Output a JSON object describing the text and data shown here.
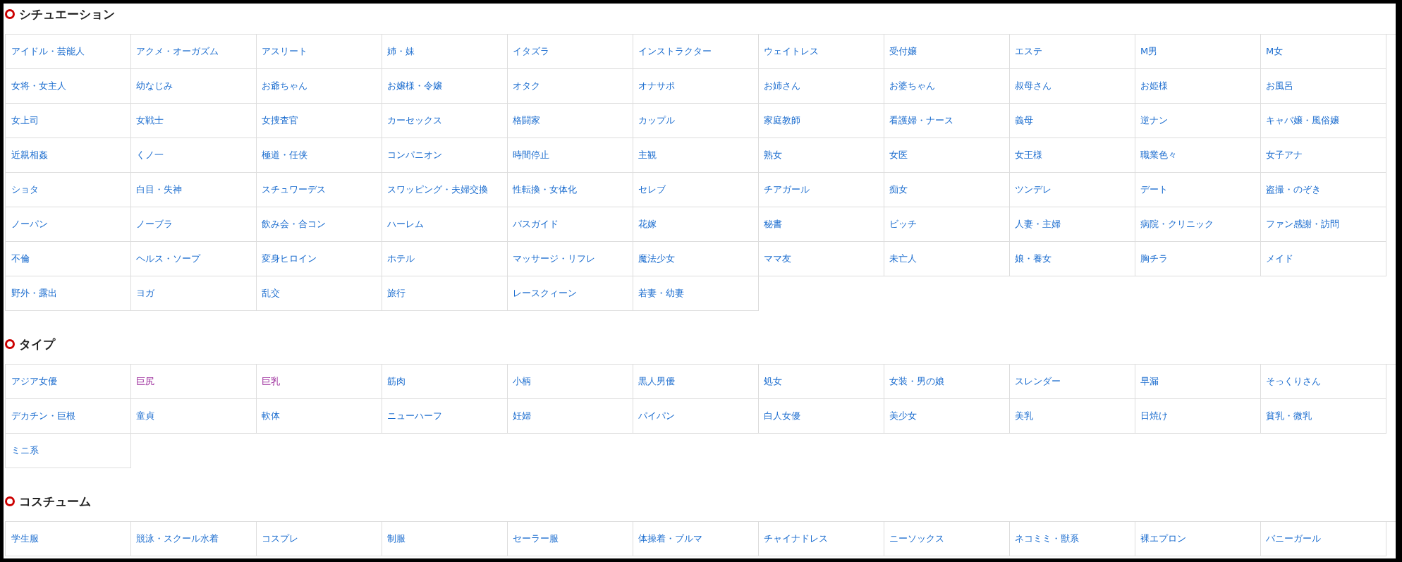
{
  "sections": [
    {
      "title": "シチュエーション",
      "items": [
        {
          "label": "アイドル・芸能人",
          "visited": false
        },
        {
          "label": "アクメ・オーガズム",
          "visited": false
        },
        {
          "label": "アスリート",
          "visited": false
        },
        {
          "label": "姉・妹",
          "visited": false
        },
        {
          "label": "イタズラ",
          "visited": false
        },
        {
          "label": "インストラクター",
          "visited": false
        },
        {
          "label": "ウェイトレス",
          "visited": false
        },
        {
          "label": "受付嬢",
          "visited": false
        },
        {
          "label": "エステ",
          "visited": false
        },
        {
          "label": "M男",
          "visited": false
        },
        {
          "label": "M女",
          "visited": false
        },
        {
          "label": "女将・女主人",
          "visited": false
        },
        {
          "label": "幼なじみ",
          "visited": false
        },
        {
          "label": "お爺ちゃん",
          "visited": false
        },
        {
          "label": "お嬢様・令嬢",
          "visited": false
        },
        {
          "label": "オタク",
          "visited": false
        },
        {
          "label": "オナサポ",
          "visited": false
        },
        {
          "label": "お姉さん",
          "visited": false
        },
        {
          "label": "お婆ちゃん",
          "visited": false
        },
        {
          "label": "叔母さん",
          "visited": false
        },
        {
          "label": "お姫様",
          "visited": false
        },
        {
          "label": "お風呂",
          "visited": false
        },
        {
          "label": "女上司",
          "visited": false
        },
        {
          "label": "女戦士",
          "visited": false
        },
        {
          "label": "女捜査官",
          "visited": false
        },
        {
          "label": "カーセックス",
          "visited": false
        },
        {
          "label": "格闘家",
          "visited": false
        },
        {
          "label": "カップル",
          "visited": false
        },
        {
          "label": "家庭教師",
          "visited": false
        },
        {
          "label": "看護婦・ナース",
          "visited": false
        },
        {
          "label": "義母",
          "visited": false
        },
        {
          "label": "逆ナン",
          "visited": false
        },
        {
          "label": "キャバ嬢・風俗嬢",
          "visited": false
        },
        {
          "label": "近親相姦",
          "visited": false
        },
        {
          "label": "くノ一",
          "visited": false
        },
        {
          "label": "極道・任侠",
          "visited": false
        },
        {
          "label": "コンパニオン",
          "visited": false
        },
        {
          "label": "時間停止",
          "visited": false
        },
        {
          "label": "主観",
          "visited": false
        },
        {
          "label": "熟女",
          "visited": false
        },
        {
          "label": "女医",
          "visited": false
        },
        {
          "label": "女王様",
          "visited": false
        },
        {
          "label": "職業色々",
          "visited": false
        },
        {
          "label": "女子アナ",
          "visited": false
        },
        {
          "label": "ショタ",
          "visited": false
        },
        {
          "label": "白目・失神",
          "visited": false
        },
        {
          "label": "スチュワーデス",
          "visited": false
        },
        {
          "label": "スワッピング・夫婦交換",
          "visited": false
        },
        {
          "label": "性転換・女体化",
          "visited": false
        },
        {
          "label": "セレブ",
          "visited": false
        },
        {
          "label": "チアガール",
          "visited": false
        },
        {
          "label": "痴女",
          "visited": false
        },
        {
          "label": "ツンデレ",
          "visited": false
        },
        {
          "label": "デート",
          "visited": false
        },
        {
          "label": "盗撮・のぞき",
          "visited": false
        },
        {
          "label": "ノーパン",
          "visited": false
        },
        {
          "label": "ノーブラ",
          "visited": false
        },
        {
          "label": "飲み会・合コン",
          "visited": false
        },
        {
          "label": "ハーレム",
          "visited": false
        },
        {
          "label": "バスガイド",
          "visited": false
        },
        {
          "label": "花嫁",
          "visited": false
        },
        {
          "label": "秘書",
          "visited": false
        },
        {
          "label": "ビッチ",
          "visited": false
        },
        {
          "label": "人妻・主婦",
          "visited": false
        },
        {
          "label": "病院・クリニック",
          "visited": false
        },
        {
          "label": "ファン感謝・訪問",
          "visited": false
        },
        {
          "label": "不倫",
          "visited": false
        },
        {
          "label": "ヘルス・ソープ",
          "visited": false
        },
        {
          "label": "変身ヒロイン",
          "visited": false
        },
        {
          "label": "ホテル",
          "visited": false
        },
        {
          "label": "マッサージ・リフレ",
          "visited": false
        },
        {
          "label": "魔法少女",
          "visited": false
        },
        {
          "label": "ママ友",
          "visited": false
        },
        {
          "label": "未亡人",
          "visited": false
        },
        {
          "label": "娘・養女",
          "visited": false
        },
        {
          "label": "胸チラ",
          "visited": false
        },
        {
          "label": "メイド",
          "visited": false
        },
        {
          "label": "野外・露出",
          "visited": false
        },
        {
          "label": "ヨガ",
          "visited": false
        },
        {
          "label": "乱交",
          "visited": false
        },
        {
          "label": "旅行",
          "visited": false
        },
        {
          "label": "レースクィーン",
          "visited": false
        },
        {
          "label": "若妻・幼妻",
          "visited": false
        }
      ]
    },
    {
      "title": "タイプ",
      "items": [
        {
          "label": "アジア女優",
          "visited": false
        },
        {
          "label": "巨尻",
          "visited": true
        },
        {
          "label": "巨乳",
          "visited": true
        },
        {
          "label": "筋肉",
          "visited": false
        },
        {
          "label": "小柄",
          "visited": false
        },
        {
          "label": "黒人男優",
          "visited": false
        },
        {
          "label": "処女",
          "visited": false
        },
        {
          "label": "女装・男の娘",
          "visited": false
        },
        {
          "label": "スレンダー",
          "visited": false
        },
        {
          "label": "早漏",
          "visited": false
        },
        {
          "label": "そっくりさん",
          "visited": false
        },
        {
          "label": "デカチン・巨根",
          "visited": false
        },
        {
          "label": "童貞",
          "visited": false
        },
        {
          "label": "軟体",
          "visited": false
        },
        {
          "label": "ニューハーフ",
          "visited": false
        },
        {
          "label": "妊婦",
          "visited": false
        },
        {
          "label": "パイパン",
          "visited": false
        },
        {
          "label": "白人女優",
          "visited": false
        },
        {
          "label": "美少女",
          "visited": false
        },
        {
          "label": "美乳",
          "visited": false
        },
        {
          "label": "日焼け",
          "visited": false
        },
        {
          "label": "貧乳・微乳",
          "visited": false
        },
        {
          "label": "ミニ系",
          "visited": false
        }
      ]
    },
    {
      "title": "コスチューム",
      "items": [
        {
          "label": "学生服",
          "visited": false
        },
        {
          "label": "競泳・スクール水着",
          "visited": false
        },
        {
          "label": "コスプレ",
          "visited": false
        },
        {
          "label": "制服",
          "visited": false
        },
        {
          "label": "セーラー服",
          "visited": false
        },
        {
          "label": "体操着・ブルマ",
          "visited": false
        },
        {
          "label": "チャイナドレス",
          "visited": false
        },
        {
          "label": "ニーソックス",
          "visited": false
        },
        {
          "label": "ネコミミ・獣系",
          "visited": false
        },
        {
          "label": "裸エプロン",
          "visited": false
        },
        {
          "label": "バニーガール",
          "visited": false
        }
      ]
    }
  ]
}
